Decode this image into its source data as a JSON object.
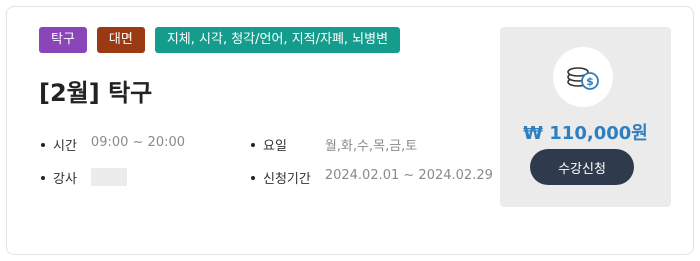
{
  "badges": [
    "탁구",
    "대면",
    "지체, 시각, 청각/언어, 지적/자폐, 뇌병변"
  ],
  "title": "[2월] 탁구",
  "info": {
    "time_label": "시간",
    "time_value": "09:00 ~ 20:00",
    "instructor_label": "강사",
    "day_label": "요일",
    "day_value": "월,화,수,목,금,토",
    "period_label": "신청기간",
    "period_value": "2024.02.01 ~ 2024.02.29"
  },
  "price": "₩ 110,000원",
  "apply_button": "수강신청",
  "icons": {
    "price": "coin-stack-icon"
  },
  "colors": {
    "badge_sport": "#8a45b8",
    "badge_mode": "#9a3a12",
    "badge_disability": "#149c8c",
    "price_text": "#2f7fc0",
    "button_bg": "#2f3b4c"
  }
}
